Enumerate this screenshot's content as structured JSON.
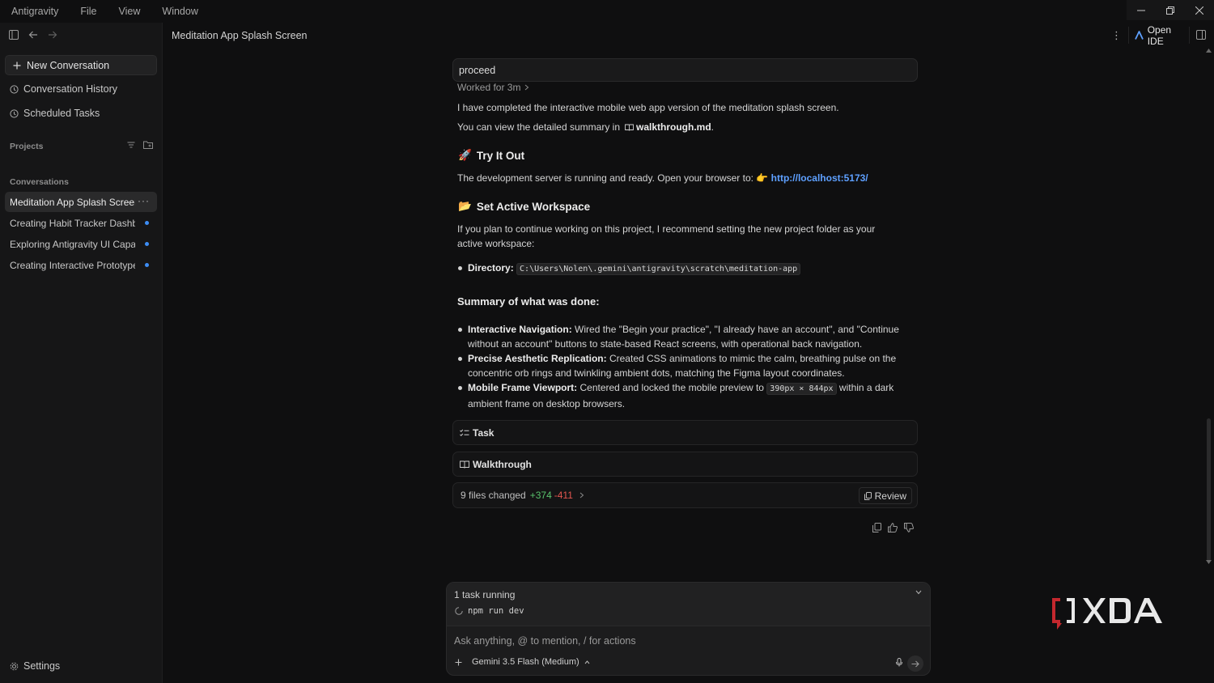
{
  "menubar": {
    "items": [
      "Antigravity",
      "File",
      "View",
      "Window"
    ]
  },
  "sidebar": {
    "new_conversation": "New Conversation",
    "history": "Conversation History",
    "scheduled": "Scheduled Tasks",
    "projects_title": "Projects",
    "conversations_title": "Conversations",
    "conversations": [
      {
        "label": "Meditation App Splash Screen",
        "active": true
      },
      {
        "label": "Creating Habit Tracker Dashb..."
      },
      {
        "label": "Exploring Antigravity UI Capa..."
      },
      {
        "label": "Creating Interactive Prototype"
      }
    ],
    "more": "···",
    "settings": "Settings"
  },
  "header": {
    "title": "Meditation App Splash Screen",
    "open_ide": "Open IDE",
    "kebab": "⋮"
  },
  "chat": {
    "prompt": "proceed",
    "worked": "Worked for 3m",
    "p1": "I have completed the interactive mobile web app version of the meditation splash screen.",
    "p2_prefix": "You can view the detailed summary in",
    "p2_file": "walkthrough.md",
    "p2_suffix": ".",
    "h_try": "Try It Out",
    "try_emoji": "🚀",
    "p3_prefix": "The development server is running and ready. Open your browser to:",
    "point_emoji": "👉",
    "p3_link": "http://localhost:5173/",
    "h_workspace": "Set Active Workspace",
    "folder_emoji": "📂",
    "p4": "If you plan to continue working on this project, I recommend setting the new project folder as your active workspace:",
    "dir_label": "Directory:",
    "dir_path": "C:\\Users\\Nolen\\.gemini\\antigravity\\scratch\\meditation-app",
    "h_summary": "Summary of what was done:",
    "b1_title": "Interactive Navigation:",
    "b1_text": "Wired the \"Begin your practice\", \"I already have an account\", and \"Continue without an account\" buttons to state-based React screens, with operational back navigation.",
    "b2_title": "Precise Aesthetic Replication:",
    "b2_text": "Created CSS animations to mimic the calm, breathing pulse on the concentric orb rings and twinkling ambient dots, matching the Figma layout coordinates.",
    "b3_title": "Mobile Frame Viewport:",
    "b3_pre": "Centered and locked the mobile preview to",
    "b3_code": "390px × 844px",
    "b3_post": "within a dark ambient frame on desktop browsers.",
    "task_card": "Task",
    "walk_card": "Walkthrough",
    "files_changed": "9 files changed",
    "additions": "+374",
    "deletions": "-411",
    "review": "Review"
  },
  "composer": {
    "tasks_running": "1 task running",
    "task_cmd": "npm run dev",
    "placeholder": "Ask anything, @ to mention, / for actions",
    "model": "Gemini 3.5 Flash (Medium)"
  },
  "watermark": "XDA",
  "colors": {
    "accent_blue": "#3d8df5",
    "link": "#5ea0ff",
    "added": "#58c26c",
    "deleted": "#e2554f"
  }
}
